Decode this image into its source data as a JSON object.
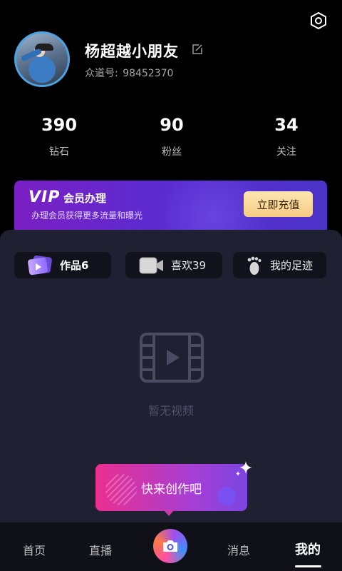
{
  "profile": {
    "username": "杨超越小朋友",
    "id_label": "众道号:",
    "id_value": "98452370"
  },
  "stats": [
    {
      "value": "390",
      "label": "钻石"
    },
    {
      "value": "90",
      "label": "粉丝"
    },
    {
      "value": "34",
      "label": "关注"
    }
  ],
  "vip": {
    "logo": "VIP",
    "title": "会员办理",
    "subtitle": "办理会员获得更多流量和曝光",
    "button": "立即充值"
  },
  "tabs": [
    {
      "label": "作品6",
      "icon": "video-card-icon"
    },
    {
      "label": "喜欢39",
      "icon": "video-camera-icon"
    },
    {
      "label": "我的足迹",
      "icon": "footprint-icon"
    }
  ],
  "empty_state": {
    "text": "暂无视频",
    "icon": "film-icon"
  },
  "cta": {
    "label": "快来创作吧"
  },
  "bottom_nav": {
    "home": "首页",
    "live": "直播",
    "camera": "camera-icon",
    "messages": "消息",
    "me": "我的"
  },
  "colors": {
    "background": "#000000",
    "panel": "#1f2031",
    "vip_start": "#7b1fc4",
    "vip_end": "#4b33c8",
    "vip_button": "#f7cc84",
    "cta_start": "#ea2f8f",
    "cta_end": "#7b45e0"
  }
}
